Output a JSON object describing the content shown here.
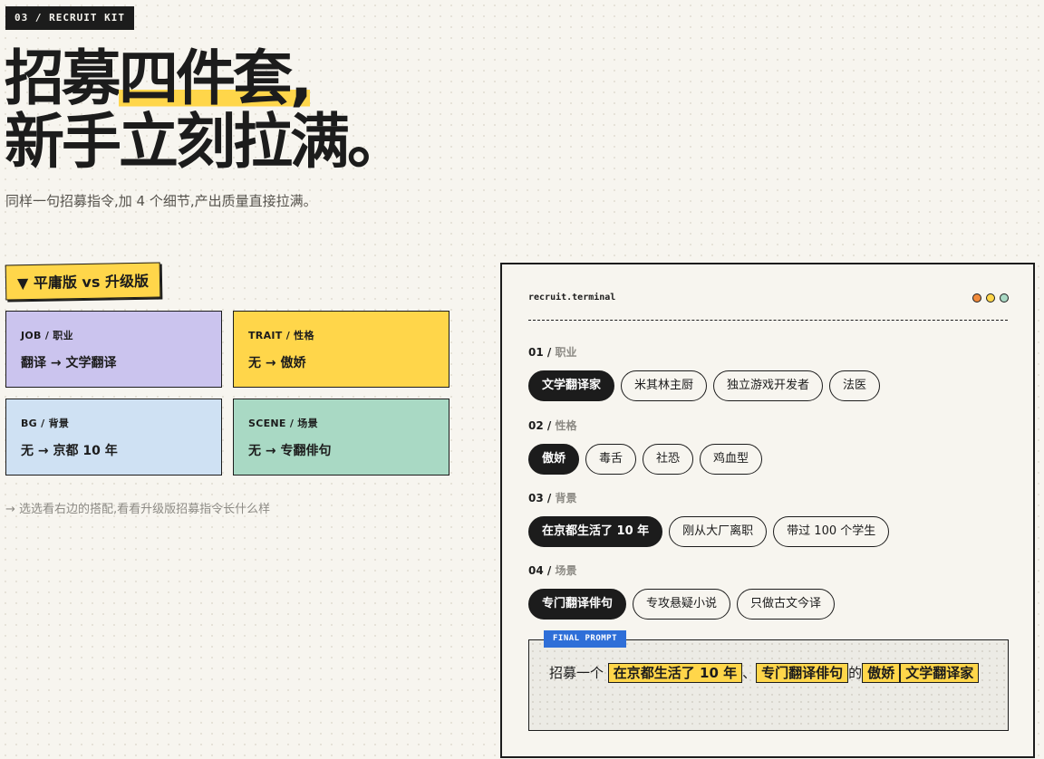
{
  "kicker": "03 / RECRUIT KIT",
  "headline": {
    "line1_pre": "招募",
    "line1_hl": "四件套,",
    "line2": "新手立刻拉满。"
  },
  "subtitle": "同样一句招募指令,加 4 个细节,产出质量直接拉满。",
  "compare": {
    "tag": "▼ 平庸版 vs 升级版",
    "cards": [
      {
        "label": "JOB / 职业",
        "value": "翻译  →  文学翻译",
        "color": "#cbc4ee"
      },
      {
        "label": "TRAIT / 性格",
        "value": "无  →  傲娇",
        "color": "#ffd64a"
      },
      {
        "label": "BG / 背景",
        "value": "无  →  京都 10 年",
        "color": "#cfe1f3"
      },
      {
        "label": "SCENE / 场景",
        "value": "无  →  专翻俳句",
        "color": "#a9d9c4"
      }
    ],
    "hint": "→ 选选看右边的搭配,看看升级版招募指令长什么样"
  },
  "terminal": {
    "title": "recruit.terminal",
    "dots": [
      "#f08a3c",
      "#ffd64a",
      "#a9d9c4"
    ],
    "sections": [
      {
        "num": "01",
        "label": "职业",
        "options": [
          "文学翻译家",
          "米其林主厨",
          "独立游戏开发者",
          "法医"
        ],
        "selected": "文学翻译家"
      },
      {
        "num": "02",
        "label": "性格",
        "options": [
          "傲娇",
          "毒舌",
          "社恐",
          "鸡血型"
        ],
        "selected": "傲娇"
      },
      {
        "num": "03",
        "label": "背景",
        "options": [
          "在京都生活了 10 年",
          "刚从大厂离职",
          "带过 100 个学生"
        ],
        "selected": "在京都生活了 10 年"
      },
      {
        "num": "04",
        "label": "场景",
        "options": [
          "专门翻译俳句",
          "专攻悬疑小说",
          "只做古文今译"
        ],
        "selected": "专门翻译俳句"
      }
    ],
    "final": {
      "tag": "FINAL PROMPT",
      "prefix": "招募一个",
      "bg": "在京都生活了 10 年",
      "sep": "、",
      "scene": "专门翻译俳句",
      "of": "的",
      "trait": "傲娇",
      "job": "文学翻译家"
    }
  },
  "accent_colors": {
    "yellow": "#ffd64a",
    "ink": "#1c1c1c",
    "blue": "#2f6fd8"
  }
}
